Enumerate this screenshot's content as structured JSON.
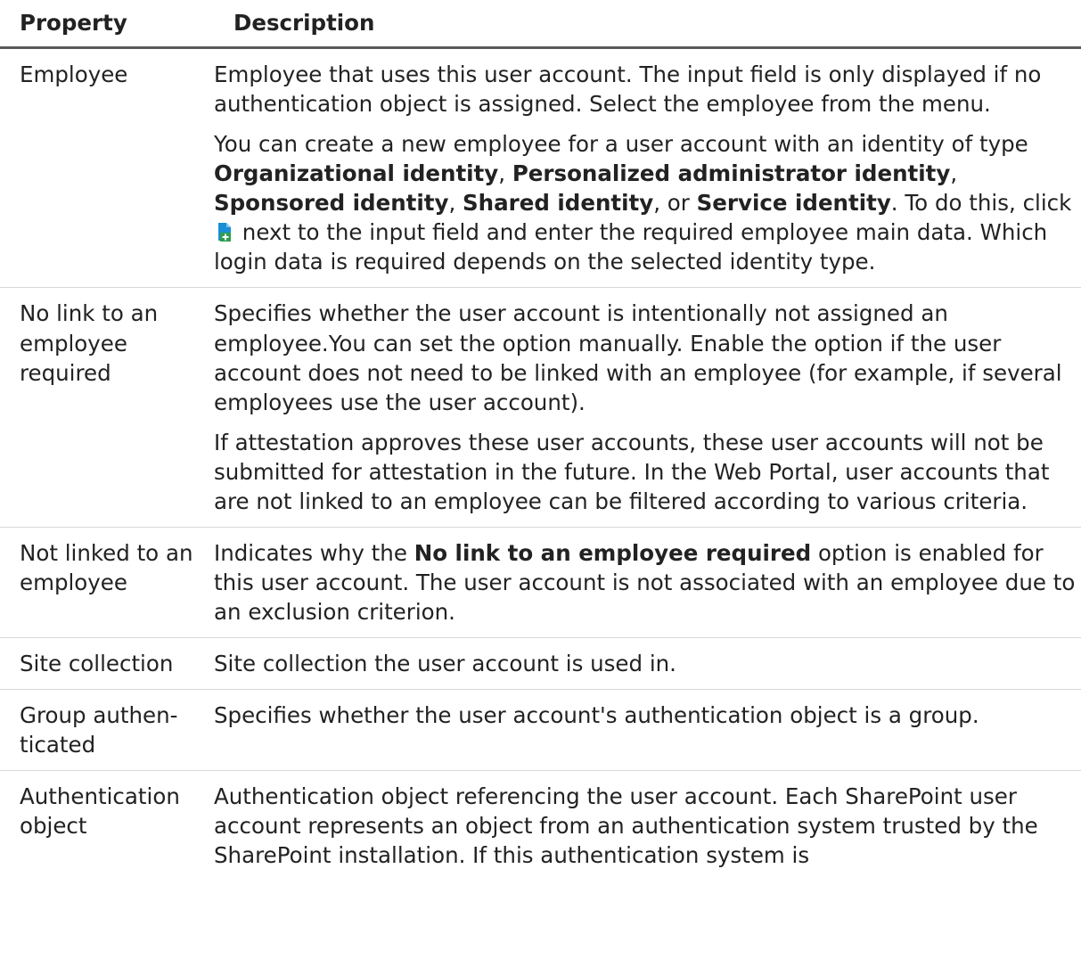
{
  "header": {
    "property": "Property",
    "description": "Description"
  },
  "rows": [
    {
      "property": "Employee",
      "p1": "Employee that uses this user account. The input field is only displayed if no authentication object is assigned. Select the employee from the menu.",
      "p2": {
        "t1": "You can create a new employee for a user account with an identity of type ",
        "b1": "Organizational identity",
        "t2": ", ",
        "b2": "Personalized administrator identity",
        "t3": ", ",
        "b3": "Sponsored identity",
        "t4": ", ",
        "b4": "Shared identity",
        "t5": ", or ",
        "b5": "Service identity",
        "t6": ". To do this, click ",
        "t7": " next to the input field and enter the required employee main data. Which login data is required depends on the selected identity type."
      }
    },
    {
      "property": "No link to an employee required",
      "p1": "Specifies whether the user account is intentionally not assigned an employee.You can set the option manually. Enable the option if the user account does not need to be linked with an employee (for example, if several employees use the user account).",
      "p2": "If attestation approves these user accounts, these user accounts will not be submitted for attestation in the future. In the Web Portal, user accounts that are not linked to an employee can be filtered according to various criteria."
    },
    {
      "property": "Not linked to an employee",
      "t1": "Indicates why the ",
      "b1": "No link to an employee required",
      "t2": " option is enabled for this user account. The user account is not associated with an employee due to an exclusion criterion."
    },
    {
      "property": "Site collection",
      "p1": "Site collection the user account is used in."
    },
    {
      "property": "Group authen-ticated",
      "p1": "Specifies whether the user account's authentication object is a group."
    },
    {
      "property": "Authentication object",
      "p1": "Authentication object referencing the user account. Each SharePoint user account represents an object from an authentication system trusted by the SharePoint installation. If this authentication system is"
    }
  ],
  "icons": {
    "add": "add-new-icon",
    "add_color": "#1a8fd6"
  }
}
